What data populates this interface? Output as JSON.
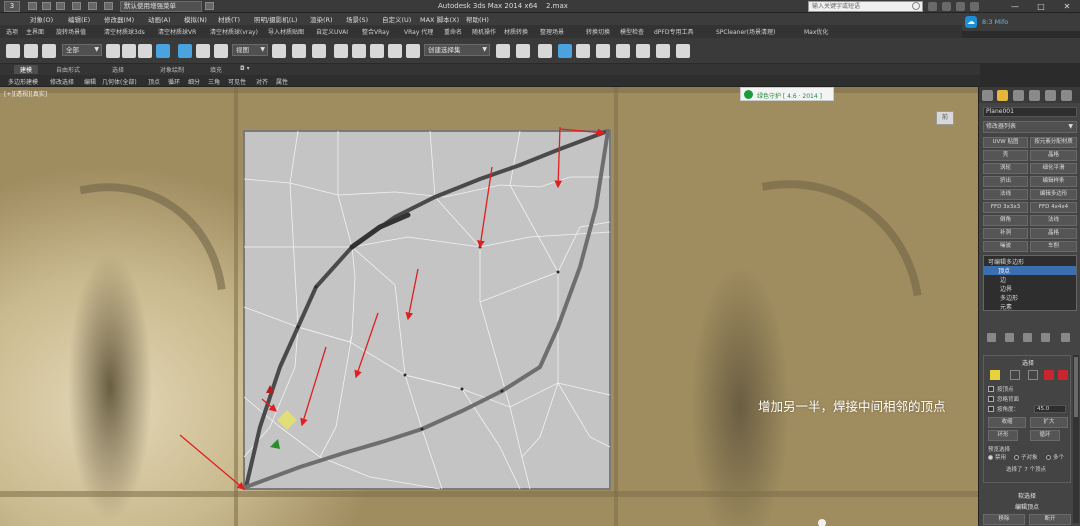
{
  "titlebar": {
    "logo": "3",
    "workspace": "默认使用增强菜单",
    "app_title": "Autodesk 3ds Max  2014 x64",
    "file_name": "2.max",
    "search_placeholder": "输入关键字或短语",
    "window_controls": [
      "—",
      "□",
      "✕"
    ]
  },
  "signin": {
    "label": "8:3 Mifo"
  },
  "menu": [
    "对象(O)",
    "编辑(E)",
    "修改器(M)",
    "动画(A)",
    "模拟(N)",
    "材质(T)",
    "照明/摄影机(L)",
    "渲染(R)",
    "场景(S)",
    "自定义(U)",
    "MAX 脚本(X)",
    "帮助(H)"
  ],
  "plugins": [
    "选项",
    "主界面",
    "旋转场景值",
    "清空材质球3ds",
    "清空材质球VR",
    "清空材质球(vray)",
    "导入材质贴图",
    "自定义UVAI",
    "整合VRay",
    "VRay 代理",
    "重命名",
    "随机操作",
    "材质转换",
    "整理场景",
    "转换切换",
    "模型检查",
    "dPFD专用工具",
    "SPCleaner(场景清理)",
    "Max优化"
  ],
  "toolbar": {
    "selection_filter": "全部",
    "view_mode": "视图",
    "named_selection": "创建选择集"
  },
  "ribbon": {
    "tabs": [
      "建模",
      "自由形式",
      "选择",
      "对象绘制",
      "填充"
    ],
    "active_index": 0
  },
  "subbar": [
    "多边形建模",
    "修改选择",
    "编辑",
    "几何体(全部)",
    "顶点",
    "循环",
    "细分",
    "三角",
    "可见性",
    "对齐",
    "属性"
  ],
  "viewport": {
    "label": "[+][透视][真实]",
    "viewcube_label": "前",
    "badge": "绿色守护 [ 4.6 · 2014 ]",
    "caption": "增加另一半，焊接中间相邻的顶点"
  },
  "command_panel": {
    "object_name": "Plane001",
    "modifier_list": "修改器列表",
    "buttons": [
      "UVW 贴图",
      "按元素分配材质",
      "壳",
      "晶格",
      "涡轮",
      "细化平滑",
      "挤出",
      "编辑样条",
      "法线",
      "编辑多边形",
      "FFD 3x3x3",
      "FFD 4x4x4",
      "倒角",
      "法线",
      "补洞",
      "晶格",
      "噪波",
      "车削"
    ],
    "stack": [
      "可编辑多边形",
      "顶点",
      "边",
      "边界",
      "多边形",
      "元素"
    ],
    "stack_selected": 1,
    "selection": {
      "title": "选择",
      "checkboxes": [
        "按顶点",
        "忽略背面",
        "按角度："
      ],
      "angle_value": "45.0",
      "buttons": [
        "收缩",
        "扩大",
        "环形",
        "循环"
      ],
      "preview_label": "预览选择",
      "radio": [
        "禁用",
        "子对象",
        "多个"
      ],
      "radio_selected": 0,
      "info": "选择了 7 个顶点"
    },
    "soft_selection": "软选择",
    "edit_vertices": "编辑顶点",
    "bottom_buttons": [
      "移除",
      "断开"
    ]
  },
  "colors": {
    "accent_blue": "#3b6fb0",
    "viewport_fabric": "#c9b98e",
    "arrow_red": "#e02020",
    "mesh_fill": "#c4c4c4"
  }
}
